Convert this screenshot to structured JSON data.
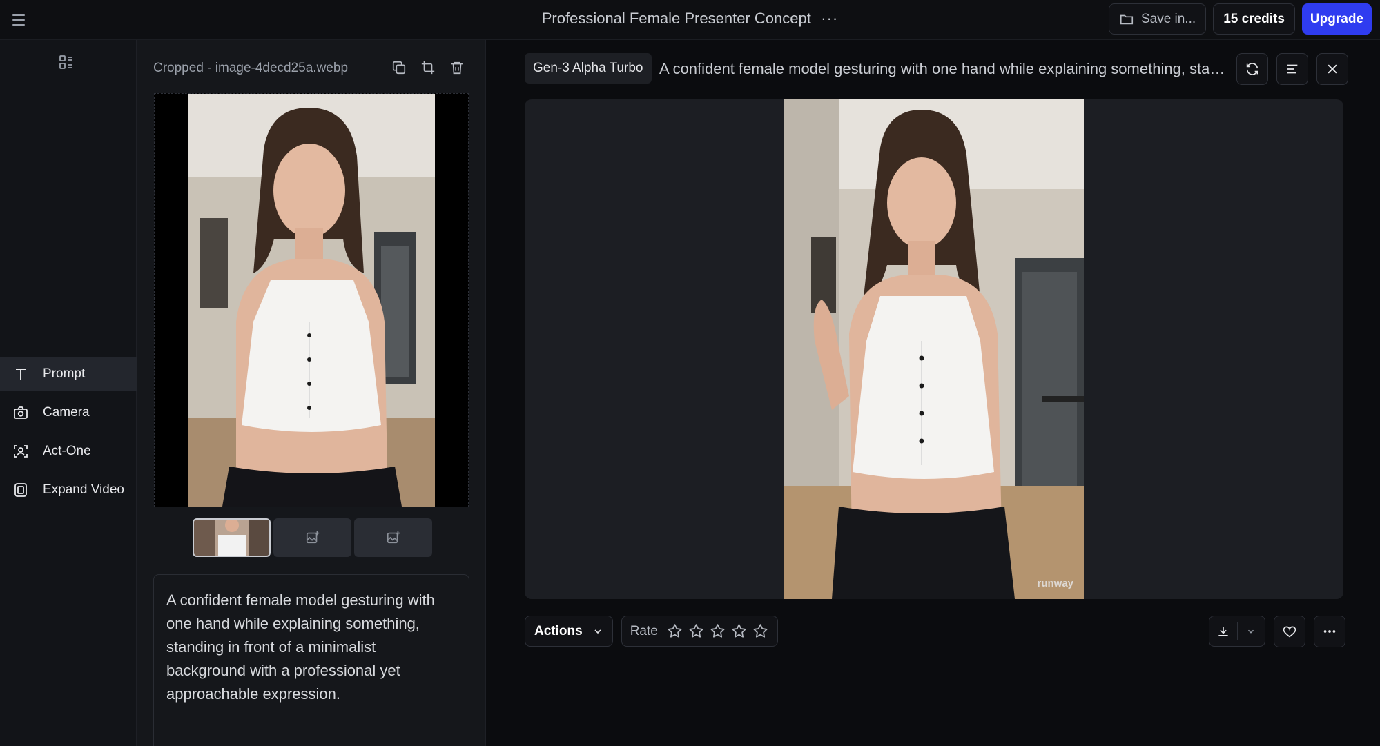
{
  "header": {
    "title": "Professional Female Presenter Concept",
    "more": "···",
    "save_label": "Save in...",
    "credits_label": "15 credits",
    "upgrade_label": "Upgrade"
  },
  "nav": {
    "items": [
      {
        "label": "Prompt",
        "icon": "text-t-icon",
        "active": true
      },
      {
        "label": "Camera",
        "icon": "camera-icon",
        "active": false
      },
      {
        "label": "Act-One",
        "icon": "face-scan-icon",
        "active": false
      },
      {
        "label": "Expand Video",
        "icon": "film-icon",
        "active": false
      }
    ]
  },
  "source": {
    "file_name": "Cropped - image-4decd25a.webp",
    "prompt_text": "A confident female model gesturing with one hand while explaining something, standing in front of a minimalist background with a professional yet approachable expression."
  },
  "generation": {
    "model": "Gen-3 Alpha Turbo",
    "prompt": "A confident female model gesturing with one hand while explaining something, standing in front of a minimalist background with a professional yet approachable expression.",
    "watermark": "runway",
    "actions_label": "Actions",
    "rate_label": "Rate",
    "rating": 0,
    "rating_max": 5
  },
  "colors": {
    "accent": "#2f3cf0",
    "background": "#0b0c0f",
    "panel": "#15171b"
  }
}
